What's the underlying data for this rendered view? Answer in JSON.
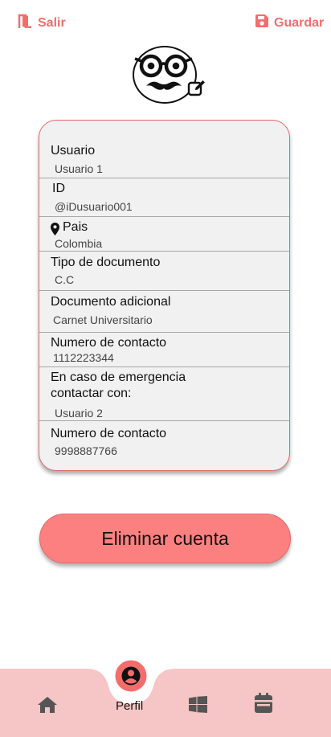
{
  "header": {
    "exit_label": "Salir",
    "save_label": "Guardar"
  },
  "profile": {
    "fields": {
      "usuario": {
        "label": "Usuario",
        "value": "Usuario 1"
      },
      "id": {
        "label": "ID",
        "value": "@iDusuario001"
      },
      "pais": {
        "label": "Pais",
        "value": "Colombia"
      },
      "tipo_documento": {
        "label": "Tipo de documento",
        "value": "C.C"
      },
      "documento_adicional": {
        "label": "Documento adicional",
        "value": "Carnet Universitario"
      },
      "numero_contacto": {
        "label": "Numero de contacto",
        "value": "1112223344"
      },
      "emergencia_line1": "En caso de emergencia",
      "emergencia_line2": "contactar con:",
      "emergencia_value": "Usuario 2",
      "numero_contacto_2": {
        "label": "Numero de contacto",
        "value": "9998887766"
      }
    }
  },
  "actions": {
    "delete_account_label": "Eliminar cuenta"
  },
  "navbar": {
    "active_label": "Perfil",
    "items": [
      "home-icon",
      "profile-icon",
      "windows-icon",
      "calendar-icon"
    ]
  },
  "colors": {
    "accent": "#f46d6d",
    "button": "#fd8080",
    "navbar": "#f6c5c5",
    "card": "#f1f1f1"
  }
}
